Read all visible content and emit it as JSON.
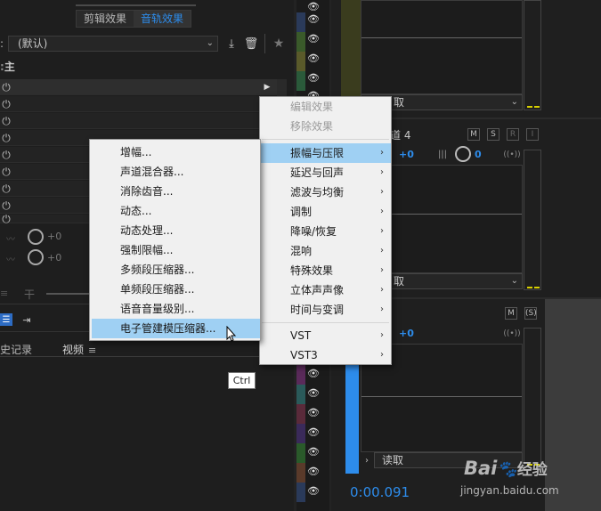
{
  "tabs": [
    "剪辑效果",
    "音轨效果"
  ],
  "preset": {
    "label": ":",
    "value": "(默认)"
  },
  "rack_title": "主",
  "knob_value": "+0",
  "bottom_tabs": {
    "history": "史记录",
    "video": "视频"
  },
  "track4_label": "道 4",
  "read_label": "取",
  "read_label_full": "读取",
  "track_values": {
    "pan": "+0",
    "vol": "0"
  },
  "ms_buttons": [
    "M",
    "S",
    "R",
    "I"
  ],
  "timecode": "0:00.091",
  "watermark": {
    "brand": "Bai",
    "suffix": "经验",
    "url": "jingyan.baidu.com"
  },
  "context_menu": {
    "items": [
      {
        "label": "编辑效果",
        "disabled": true
      },
      {
        "label": "移除效果",
        "disabled": true
      },
      {
        "label": "振幅与压限",
        "submenu": true,
        "highlighted": true
      },
      {
        "label": "延迟与回声",
        "submenu": true
      },
      {
        "label": "滤波与均衡",
        "submenu": true
      },
      {
        "label": "调制",
        "submenu": true
      },
      {
        "label": "降噪/恢复",
        "submenu": true
      },
      {
        "label": "混响",
        "submenu": true
      },
      {
        "label": "特殊效果",
        "submenu": true
      },
      {
        "label": "立体声声像",
        "submenu": true
      },
      {
        "label": "时间与变调",
        "submenu": true
      },
      {
        "label": "VST",
        "submenu": true
      },
      {
        "label": "VST3",
        "submenu": true
      }
    ]
  },
  "submenu": {
    "items": [
      {
        "label": "增幅..."
      },
      {
        "label": "声道混合器..."
      },
      {
        "label": "消除齿音..."
      },
      {
        "label": "动态..."
      },
      {
        "label": "动态处理..."
      },
      {
        "label": "强制限幅..."
      },
      {
        "label": "多频段压缩器..."
      },
      {
        "label": "单频段压缩器..."
      },
      {
        "label": "语音音量级别..."
      },
      {
        "label": "电子管建模压缩器...",
        "highlighted": true
      }
    ]
  },
  "tooltip": "Ctrl",
  "colors": {
    "accent": "#2d8ceb",
    "highlight": "#9fd0f3",
    "timecode": "#2d8ceb"
  }
}
